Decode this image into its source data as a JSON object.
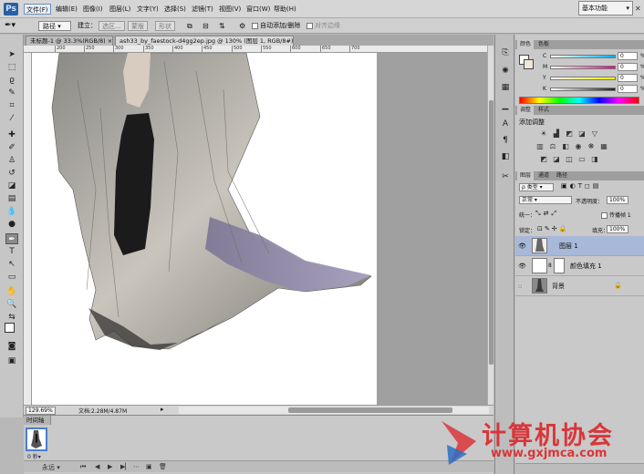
{
  "app": {
    "logo": "Ps"
  },
  "menu": {
    "items": [
      "文件(F)",
      "编辑(E)",
      "图像(I)",
      "图层(L)",
      "文字(Y)",
      "选择(S)",
      "滤镜(T)",
      "视图(V)",
      "窗口(W)",
      "帮助(H)"
    ],
    "workspace": "基本功能"
  },
  "options": {
    "path_mode": "路径",
    "make_label": "建立：",
    "selection_btn": "选区...",
    "mask_btn": "蒙版",
    "shape_btn": "形状",
    "auto_add_delete": "自动添加/删除",
    "align_edges": "对齐边缘"
  },
  "tabs": [
    {
      "label": "未标题-1 @ 33.3%(RGB/8)",
      "close": "×"
    },
    {
      "label": "ash33_by_faestock-d4gg2ep.jpg @ 130% (图层 1, RGB/8#) *",
      "close": "×"
    }
  ],
  "ruler_marks": [
    "200",
    "250",
    "300",
    "350",
    "400",
    "450",
    "500",
    "550",
    "600",
    "650",
    "700"
  ],
  "status": {
    "zoom": "129.69%",
    "doc": "文档:2.28M/4.87M"
  },
  "timeline": {
    "title": "时间轴",
    "frame_time": "0 秒▾",
    "loop": "永远"
  },
  "color_panel": {
    "tabs": [
      "颜色",
      "色板"
    ],
    "rows": [
      {
        "label": "C",
        "value": "0",
        "unit": "%",
        "color": "#00aeef"
      },
      {
        "label": "M",
        "value": "0",
        "unit": "%",
        "color": "#ec008c"
      },
      {
        "label": "Y",
        "value": "0",
        "unit": "%",
        "color": "#fff200"
      },
      {
        "label": "K",
        "value": "0",
        "unit": "%",
        "color": "#222222"
      }
    ]
  },
  "adjust_panel": {
    "tabs": [
      "调整",
      "样式"
    ],
    "title": "添加调整"
  },
  "layers_panel": {
    "tabs": [
      "图层",
      "通道",
      "路径"
    ],
    "filter": "ρ 类型",
    "blend": "正常",
    "opacity_label": "不透明度：",
    "opacity": "100%",
    "lock_label": "锁定：",
    "fill_label": "填充：",
    "fill": "100%",
    "unify_label": "统一：",
    "propagate_label": "传播帧 1",
    "layers": [
      {
        "name": "图层 1",
        "selected": true,
        "lock": ""
      },
      {
        "name": "颜色填充 1",
        "selected": false,
        "lock": ""
      },
      {
        "name": "背景",
        "selected": false,
        "lock": "🔒"
      }
    ]
  },
  "watermark": {
    "cn": "计算机协会",
    "url": "www.gxjmca.com"
  }
}
